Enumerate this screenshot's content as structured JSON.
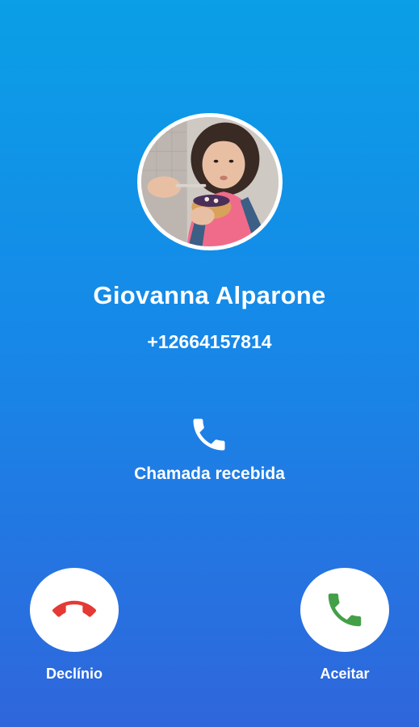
{
  "caller": {
    "name": "Giovanna Alparone",
    "number": "+12664157814",
    "avatar": "profile-photo"
  },
  "status": {
    "text": "Chamada recebida",
    "icon": "phone-icon"
  },
  "actions": {
    "decline_label": "Declínio",
    "decline_icon": "phone-hangup-icon",
    "accept_label": "Aceitar",
    "accept_icon": "phone-answer-icon"
  },
  "colors": {
    "background_top": "#0a9fe6",
    "background_bottom": "#2f66dc",
    "decline": "#e53935",
    "accept": "#43a047",
    "button_bg": "#ffffff"
  }
}
